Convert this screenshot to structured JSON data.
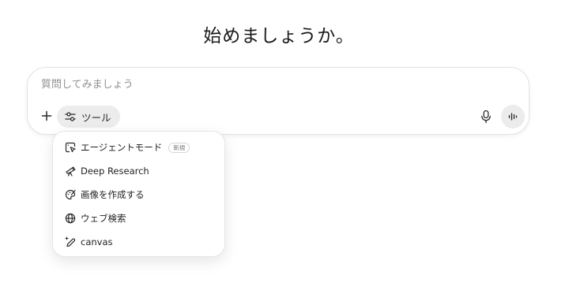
{
  "headline": "始めましょうか。",
  "composer": {
    "placeholder": "質問してみましょう",
    "value": "",
    "tools_label": "ツール"
  },
  "tools_menu": {
    "items": [
      {
        "label": "エージェントモード",
        "icon": "agent-cursor-icon",
        "badge": "新規"
      },
      {
        "label": "Deep Research",
        "icon": "telescope-icon"
      },
      {
        "label": "画像を作成する",
        "icon": "palette-icon"
      },
      {
        "label": "ウェブ検索",
        "icon": "globe-icon"
      },
      {
        "label": "canvas",
        "icon": "sparkle-pen-icon"
      }
    ]
  },
  "icons": {
    "plus": "plus-icon",
    "tools": "sliders-icon",
    "mic": "microphone-icon",
    "voice": "voice-waveform-icon"
  },
  "colors": {
    "pill_background": "#ececec",
    "text": "#0d0d0d",
    "placeholder": "#8f8f8f"
  }
}
